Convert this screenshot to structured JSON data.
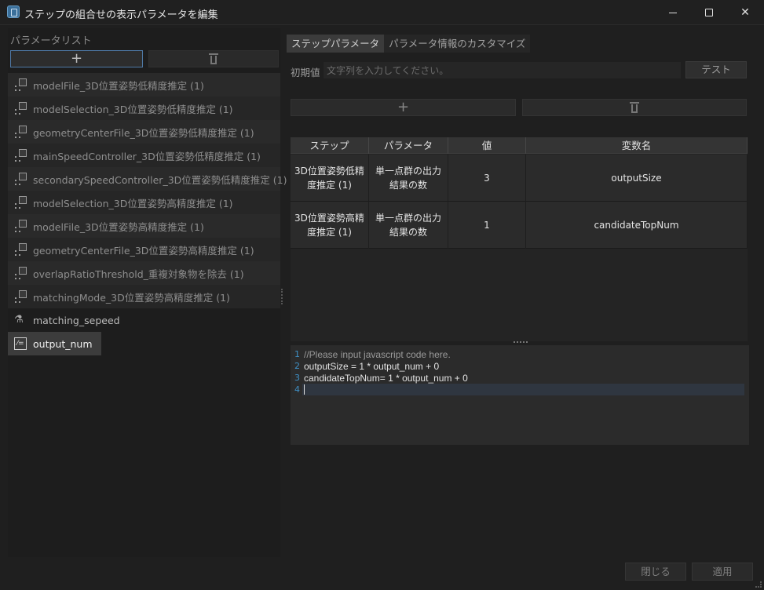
{
  "window": {
    "title": "ステップの組合せの表示パラメータを編集",
    "min_icon": "minimize-icon",
    "max_icon": "maximize-icon",
    "close_glyph": "✕"
  },
  "left": {
    "label": "パラメータリスト",
    "add_glyph": "+",
    "items": [
      {
        "label": "modelFile_3D位置姿勢低精度推定 (1)",
        "icon": "link-icon"
      },
      {
        "label": "modelSelection_3D位置姿勢低精度推定 (1)",
        "icon": "link-icon"
      },
      {
        "label": "geometryCenterFile_3D位置姿勢低精度推定 (1)",
        "icon": "link-icon"
      },
      {
        "label": "mainSpeedController_3D位置姿勢低精度推定 (1)",
        "icon": "link-icon"
      },
      {
        "label": "secondarySpeedController_3D位置姿勢低精度推定 (1)",
        "icon": "link-icon"
      },
      {
        "label": "modelSelection_3D位置姿勢高精度推定 (1)",
        "icon": "link-icon"
      },
      {
        "label": "modelFile_3D位置姿勢高精度推定 (1)",
        "icon": "link-icon"
      },
      {
        "label": "geometryCenterFile_3D位置姿勢高精度推定 (1)",
        "icon": "link-icon"
      },
      {
        "label": "overlapRatioThreshold_重複対象物を除去 (1)",
        "icon": "link-icon"
      },
      {
        "label": "matchingMode_3D位置姿勢高精度推定 (1)",
        "icon": "link-icon"
      },
      {
        "label": "matching_sepeed",
        "icon": "flask-icon"
      },
      {
        "label": "output_num",
        "icon": "variable-icon",
        "icon_text": "⁄="
      }
    ]
  },
  "right": {
    "tabs": [
      {
        "label": "ステップパラメータ"
      },
      {
        "label": "パラメータ情報のカスタマイズ"
      }
    ],
    "init_label": "初期値",
    "init_placeholder": "文字列を入力してください。",
    "init_value": "",
    "test_label": "テスト",
    "add_glyph": "+",
    "table": {
      "headers": [
        "ステップ",
        "パラメータ",
        "値",
        "変数名"
      ],
      "rows": [
        {
          "step": "3D位置姿勢低精度推定 (1)",
          "param": "単一点群の出力結果の数",
          "value": "3",
          "var": "outputSize"
        },
        {
          "step": "3D位置姿勢高精度推定 (1)",
          "param": "単一点群の出力結果の数",
          "value": "1",
          "var": "candidateTopNum"
        }
      ]
    },
    "code": {
      "lines": [
        {
          "n": "1",
          "text": "//Please input javascript code here."
        },
        {
          "n": "2",
          "text": "outputSize = 1 * output_num + 0"
        },
        {
          "n": "3",
          "text": "candidateTopNum= 1 * output_num + 0"
        },
        {
          "n": "4",
          "text": ""
        }
      ]
    }
  },
  "footer": {
    "close_label": "閉じる",
    "apply_label": "適用"
  }
}
